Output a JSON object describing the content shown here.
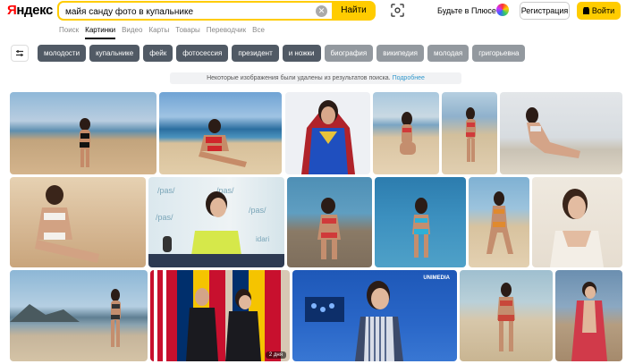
{
  "header": {
    "logo": "Яндекс",
    "search_value": "майя санду фото в купальнике",
    "search_button": "Найти",
    "plus_text": "Будьте в Плюсе",
    "register_label": "Регистрация",
    "login_label": "Войти"
  },
  "tabs": [
    "Поиск",
    "Картинки",
    "Видео",
    "Карты",
    "Товары",
    "Переводчик",
    "Все"
  ],
  "active_tab": "Картинки",
  "chips": [
    {
      "label": "молодости",
      "tone": "dark"
    },
    {
      "label": "купальнике",
      "tone": "dark"
    },
    {
      "label": "фейк",
      "tone": "dark"
    },
    {
      "label": "фотосессия",
      "tone": "dark"
    },
    {
      "label": "президент",
      "tone": "dark"
    },
    {
      "label": "и ножки",
      "tone": "dark"
    },
    {
      "label": "биография",
      "tone": "light"
    },
    {
      "label": "википедия",
      "tone": "light"
    },
    {
      "label": "молодая",
      "tone": "light"
    },
    {
      "label": "григорьевна",
      "tone": "light"
    }
  ],
  "notice": {
    "text": "Некоторые изображения были удалены из результатов поиска.",
    "link": "Подробнее"
  },
  "result_badges": {
    "time_badge": "2 дня",
    "channel_logo": "UNIMEDIA"
  },
  "colors": {
    "accent_yellow": "#ffcc00",
    "logo_red": "#ff0000",
    "chip_dark": "#515a65",
    "chip_light": "#93999f"
  }
}
